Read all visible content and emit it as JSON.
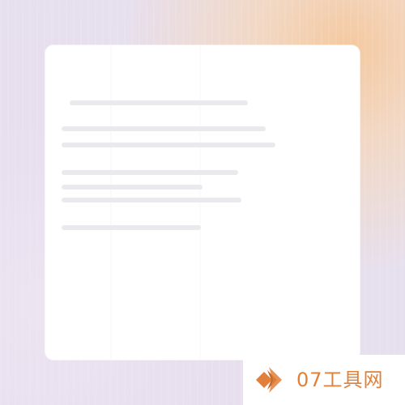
{
  "watermark": {
    "text": "07工具网",
    "colors": {
      "primary": "#e0803a",
      "secondary": "#c56a2a"
    },
    "icon": "chevron-diamond-logo-icon"
  },
  "card": {
    "placeholder_lines": 7
  }
}
